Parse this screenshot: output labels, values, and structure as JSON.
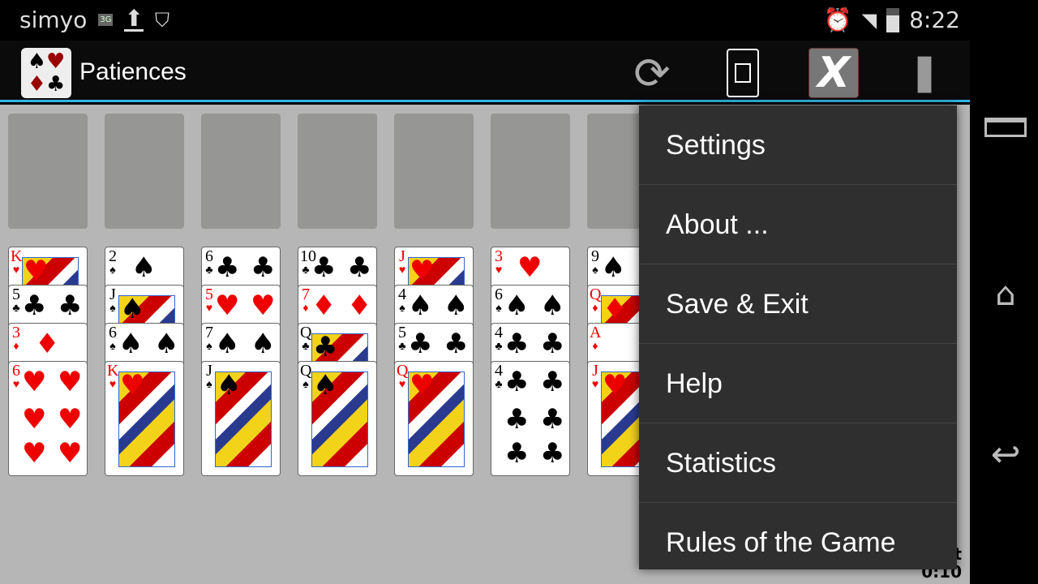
{
  "status_bar": {
    "carrier": "simyo",
    "network": "3G",
    "time": "8:22",
    "icons": [
      "3g-icon",
      "upload-icon",
      "vpn-icon",
      "alarm-icon",
      "wifi-icon",
      "signal-icon",
      "battery-icon"
    ]
  },
  "action_bar": {
    "title": "Patiences",
    "actions": [
      "restart-icon",
      "rotate-screen-icon",
      "close-game-icon",
      "overflow-menu-icon"
    ],
    "accent": "#33b5e5"
  },
  "menu": {
    "items": [
      "Settings",
      "About ...",
      "Save & Exit",
      "Help",
      "Statistics",
      "Rules of the Game"
    ]
  },
  "timer": {
    "label": "t",
    "value": "0:10"
  },
  "tableau": [
    [
      {
        "r": "K",
        "s": "♥"
      },
      {
        "r": "5",
        "s": "♣"
      },
      {
        "r": "3",
        "s": "♦"
      },
      {
        "r": "6",
        "s": "♥"
      }
    ],
    [
      {
        "r": "2",
        "s": "♠"
      },
      {
        "r": "J",
        "s": "♠"
      },
      {
        "r": "6",
        "s": "♠"
      },
      {
        "r": "K",
        "s": "♥"
      }
    ],
    [
      {
        "r": "6",
        "s": "♣"
      },
      {
        "r": "5",
        "s": "♥"
      },
      {
        "r": "7",
        "s": "♠"
      },
      {
        "r": "J",
        "s": "♠"
      }
    ],
    [
      {
        "r": "10",
        "s": "♣"
      },
      {
        "r": "7",
        "s": "♦"
      },
      {
        "r": "Q",
        "s": "♣"
      },
      {
        "r": "Q",
        "s": "♠"
      }
    ],
    [
      {
        "r": "J",
        "s": "♥"
      },
      {
        "r": "4",
        "s": "♠"
      },
      {
        "r": "5",
        "s": "♣"
      },
      {
        "r": "Q",
        "s": "♥"
      }
    ],
    [
      {
        "r": "3",
        "s": "♥"
      },
      {
        "r": "6",
        "s": "♠"
      },
      {
        "r": "4",
        "s": "♣"
      },
      {
        "r": "4",
        "s": "♣"
      }
    ],
    [
      {
        "r": "9",
        "s": "♠"
      },
      {
        "r": "Q",
        "s": "♦"
      },
      {
        "r": "A",
        "s": "♦"
      },
      {
        "r": "J",
        "s": "♥"
      }
    ]
  ]
}
